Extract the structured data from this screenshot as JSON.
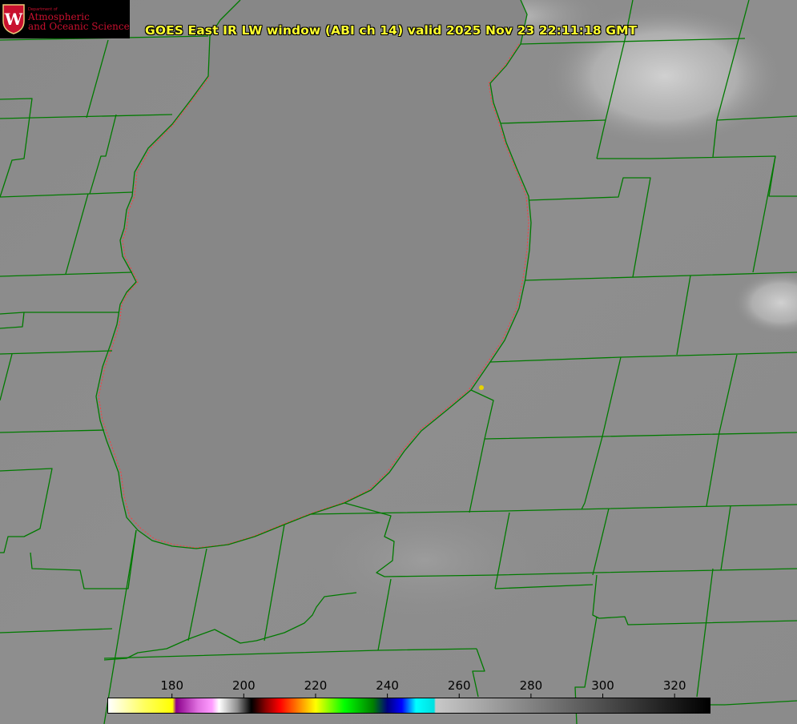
{
  "header": {
    "title": "GOES East IR LW window (ABI ch 14) valid 2025 Nov 23 22:11:18 GMT"
  },
  "logo": {
    "seal_letter": "W",
    "department": "Department of",
    "line1": "Atmospheric",
    "line2": "and Oceanic Sciences",
    "color": "#c8102e"
  },
  "colorbar": {
    "ticks": [
      {
        "value": 180,
        "label": "180"
      },
      {
        "value": 200,
        "label": "200"
      },
      {
        "value": 220,
        "label": "220"
      },
      {
        "value": 240,
        "label": "240"
      },
      {
        "value": 260,
        "label": "260"
      },
      {
        "value": 280,
        "label": "280"
      },
      {
        "value": 300,
        "label": "300"
      },
      {
        "value": 320,
        "label": "320"
      }
    ],
    "range": [
      162,
      330
    ],
    "stops": [
      {
        "value": 162,
        "color": "#ffffff"
      },
      {
        "value": 172,
        "color": "#ffff60"
      },
      {
        "value": 180,
        "color": "#ffff00"
      },
      {
        "value": 181,
        "color": "#8b008b"
      },
      {
        "value": 187,
        "color": "#e070e0"
      },
      {
        "value": 191,
        "color": "#ff9cff"
      },
      {
        "value": 193,
        "color": "#ffffff"
      },
      {
        "value": 198,
        "color": "#909090"
      },
      {
        "value": 202,
        "color": "#000000"
      },
      {
        "value": 203,
        "color": "#200000"
      },
      {
        "value": 206,
        "color": "#8b0000"
      },
      {
        "value": 210,
        "color": "#ff0000"
      },
      {
        "value": 215,
        "color": "#ff8000"
      },
      {
        "value": 220,
        "color": "#ffff00"
      },
      {
        "value": 228,
        "color": "#00ff00"
      },
      {
        "value": 236,
        "color": "#008000"
      },
      {
        "value": 240,
        "color": "#000080"
      },
      {
        "value": 244,
        "color": "#0000ff"
      },
      {
        "value": 248,
        "color": "#00ffff"
      },
      {
        "value": 253,
        "color": "#00e0e0"
      },
      {
        "value": 253.5,
        "color": "#c8c8c8"
      },
      {
        "value": 330,
        "color": "#000000"
      }
    ]
  },
  "map": {
    "land_color": "#8c8c8c",
    "lake_color": "#888888",
    "cloud_color": "#c8c8c8",
    "boundary_color": "#007a00",
    "shoreline_color": "#ff3b3b",
    "site_color": "#e6d200"
  }
}
